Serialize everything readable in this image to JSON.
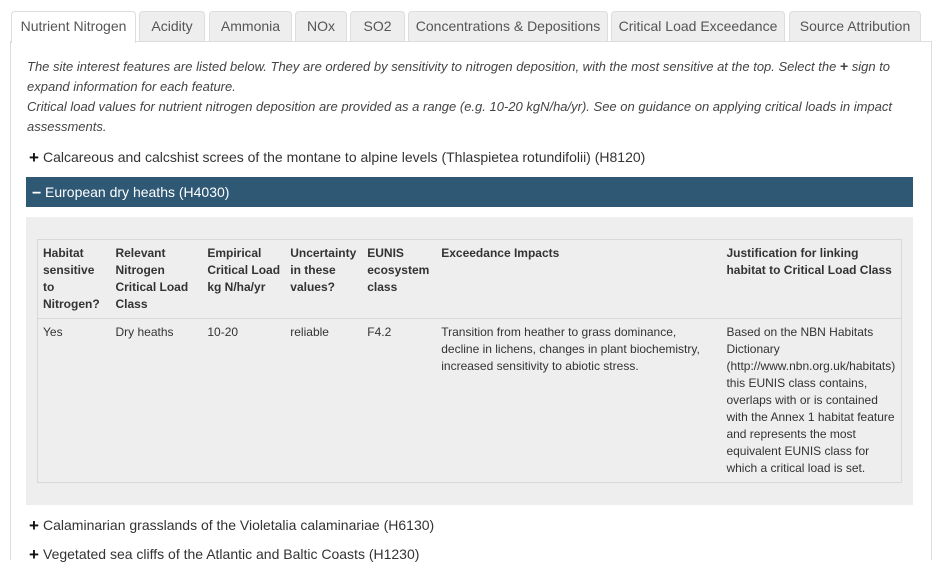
{
  "tabs": [
    {
      "label": "Nutrient Nitrogen",
      "active": true
    },
    {
      "label": "Acidity",
      "active": false
    },
    {
      "label": "Ammonia",
      "active": false
    },
    {
      "label": "NOx",
      "active": false
    },
    {
      "label": "SO2",
      "active": false
    },
    {
      "label": "Concentrations & Depositions",
      "active": false
    },
    {
      "label": "Critical Load Exceedance",
      "active": false
    },
    {
      "label": "Source Attribution",
      "active": false
    }
  ],
  "intro": {
    "line1_before": "The site interest features are listed below. They are ordered by sensitivity to nitrogen deposition, with the most sensitive at the top. Select the ",
    "plus": "+",
    "line1_after": " sign to expand information for each feature.",
    "line2": "Critical load values for nutrient nitrogen deposition are provided as a range (e.g. 10-20 kgN/ha/yr). See on guidance on applying critical loads in impact assessments."
  },
  "features": [
    {
      "sign": "+",
      "label": "Calcareous and calcshist screes of the montane to alpine levels (Thlaspietea rotundifolii) (H8120)"
    },
    {
      "sign": "−",
      "label": "European dry heaths (H4030)"
    },
    {
      "sign": "+",
      "label": "Calaminarian grasslands of the Violetalia calaminariae (H6130)"
    },
    {
      "sign": "+",
      "label": "Vegetated sea cliffs of the Atlantic and Baltic Coasts (H1230)"
    }
  ],
  "table": {
    "headers": [
      "Habitat sensitive to Nitrogen?",
      "Relevant Nitrogen Critical Load Class",
      "Empirical Critical Load kg N/ha/yr",
      "Uncertainty in these values?",
      "EUNIS ecosystem class",
      "Exceedance Impacts",
      "Justification for linking habitat to Critical Load Class"
    ],
    "row": [
      "Yes",
      "Dry heaths",
      "10-20",
      "reliable",
      "F4.2",
      "Transition from heather to grass dominance, decline in lichens, changes in plant biochemistry, increased sensitivity to abiotic stress.",
      "Based on the NBN Habitats Dictionary (http://www.nbn.org.uk/habitats) this EUNIS class contains, overlaps with or is contained with the Annex 1 habitat feature and represents the most equivalent EUNIS class for which a critical load is set."
    ]
  },
  "colors": {
    "expanded_header_bg": "#2e5874",
    "expand_area_bg": "#eeeeee",
    "tab_inactive_bg": "#eeeeee"
  }
}
